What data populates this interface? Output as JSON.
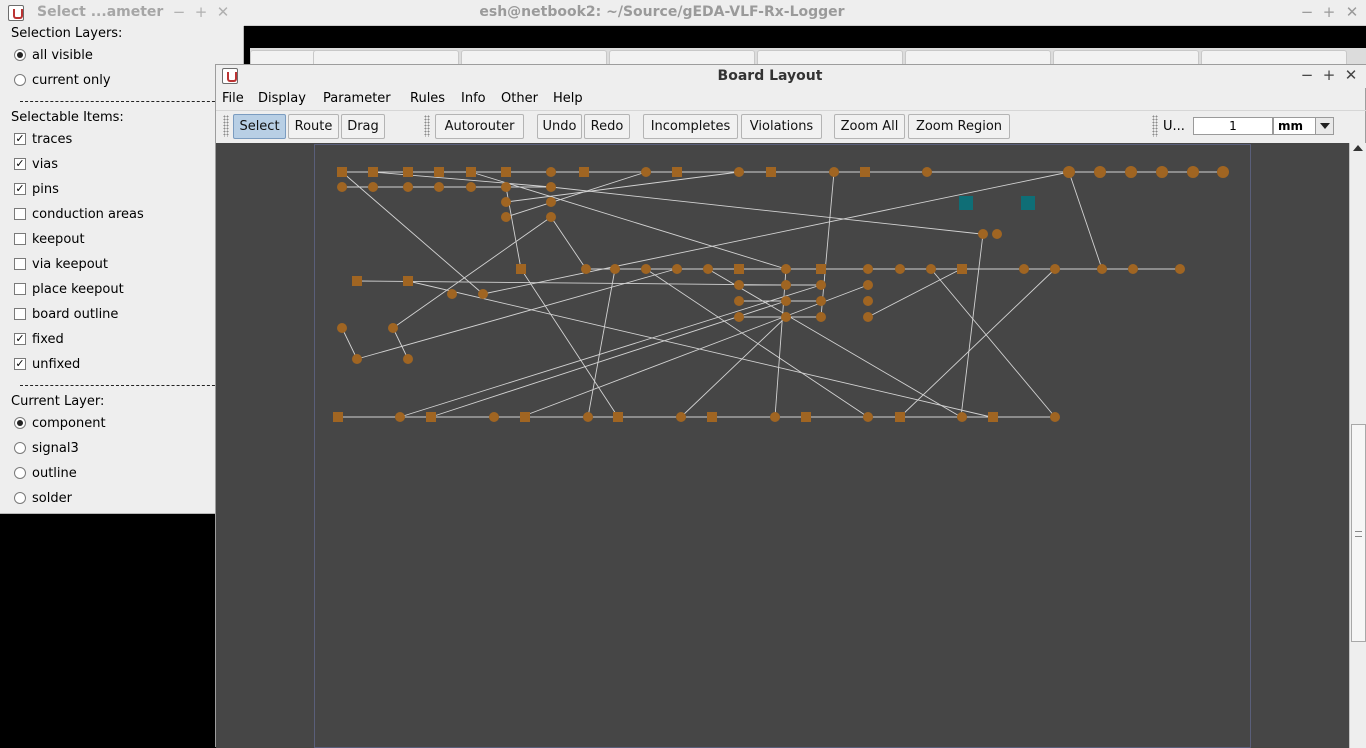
{
  "terminal": {
    "title": "esh@netbook2: ~/Source/gEDA-VLF-Rx-Logger",
    "min_glyph": "−",
    "max_glyph": "+",
    "close_glyph": "✕",
    "red_line": "                                  "
  },
  "select_dialog": {
    "title": "Select ...ameter",
    "min_glyph": "−",
    "max_glyph": "+",
    "close_glyph": "✕",
    "selection_layers_label": "Selection Layers:",
    "layer_options": [
      {
        "label": "all visible",
        "checked": true
      },
      {
        "label": "current only",
        "checked": false
      }
    ],
    "selectable_items_label": "Selectable Items:",
    "items": [
      {
        "label": "traces",
        "checked": true
      },
      {
        "label": "vias",
        "checked": true
      },
      {
        "label": "pins",
        "checked": true
      },
      {
        "label": "conduction areas",
        "checked": false
      },
      {
        "label": "keepout",
        "checked": false
      },
      {
        "label": "via keepout",
        "checked": false
      },
      {
        "label": "place keepout",
        "checked": false
      },
      {
        "label": "board outline",
        "checked": false
      },
      {
        "label": "fixed",
        "checked": true
      },
      {
        "label": "unfixed",
        "checked": true
      }
    ],
    "current_layer_label": "Current Layer:",
    "current_layers": [
      {
        "label": "component",
        "checked": true
      },
      {
        "label": "signal3",
        "checked": false
      },
      {
        "label": "outline",
        "checked": false
      },
      {
        "label": "solder",
        "checked": false
      }
    ],
    "check_glyph": "✓"
  },
  "board_window": {
    "title": "Board Layout",
    "min_glyph": "−",
    "max_glyph": "+",
    "close_glyph": "✕",
    "menu": [
      "File",
      "Display",
      "Parameter",
      "Rules",
      "Info",
      "Other",
      "Help"
    ],
    "toolbar": {
      "select": "Select",
      "route": "Route",
      "drag": "Drag",
      "autorouter": "Autorouter",
      "undo": "Undo",
      "redo": "Redo",
      "incompletes": "Incompletes",
      "violations": "Violations",
      "zoom_all": "Zoom All",
      "zoom_region": "Zoom Region",
      "unit_label": "U...",
      "unit_value": "1",
      "unit_select": "mm"
    },
    "colors": {
      "canvas": "#464646",
      "pad": "#a06522",
      "ratsnest": "#d2d2d2",
      "teal_pad": "#0f6e76"
    }
  }
}
